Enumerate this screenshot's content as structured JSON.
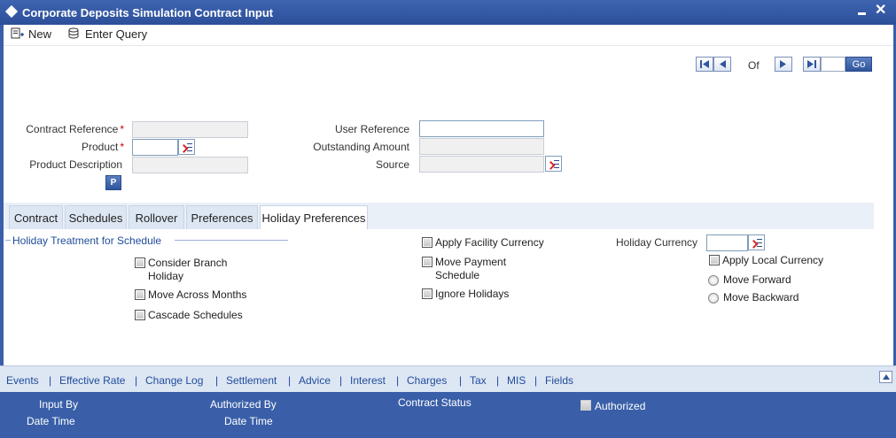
{
  "window": {
    "title": "Corporate Deposits Simulation Contract Input"
  },
  "toolbar": {
    "new_label": "New",
    "enter_query_label": "Enter Query"
  },
  "navigator": {
    "of_label": "Of",
    "go_label": "Go",
    "page_value": ""
  },
  "form": {
    "contract_reference_label": "Contract Reference",
    "product_label": "Product",
    "product_description_label": "Product Description",
    "required_mark": "*",
    "p_button_label": "P",
    "user_reference_label": "User Reference",
    "outstanding_amount_label": "Outstanding Amount",
    "source_label": "Source",
    "contract_reference_value": "",
    "product_value": "",
    "product_description_value": "",
    "user_reference_value": "",
    "outstanding_amount_value": "",
    "source_value": ""
  },
  "tabs": [
    {
      "label": "Contract"
    },
    {
      "label": "Schedules"
    },
    {
      "label": "Rollover"
    },
    {
      "label": "Preferences"
    },
    {
      "label": "Holiday Preferences"
    }
  ],
  "holiday": {
    "section_title": "Holiday Treatment for Schedule",
    "consider_branch_holiday_l1": "Consider Branch",
    "consider_branch_holiday_l2": "Holiday",
    "move_across_months": "Move Across Months",
    "cascade_schedules": "Cascade Schedules",
    "apply_facility_currency": "Apply Facility Currency",
    "move_payment_schedule_l1": "Move Payment",
    "move_payment_schedule_l2": "Schedule",
    "ignore_holidays": "Ignore Holidays",
    "holiday_currency_label": "Holiday Currency",
    "holiday_currency_value": "",
    "apply_local_currency": "Apply Local Currency",
    "move_forward": "Move Forward",
    "move_backward": "Move Backward"
  },
  "links": [
    "Events",
    "Effective Rate",
    "Change Log",
    "Settlement",
    "Advice",
    "Interest",
    "Charges",
    "Tax",
    "MIS",
    "Fields"
  ],
  "link_separator": "|",
  "footer": {
    "input_by": "Input By",
    "date_time_1": "Date Time",
    "authorized_by": "Authorized By",
    "date_time_2": "Date Time",
    "contract_status": "Contract Status",
    "authorized": "Authorized"
  }
}
